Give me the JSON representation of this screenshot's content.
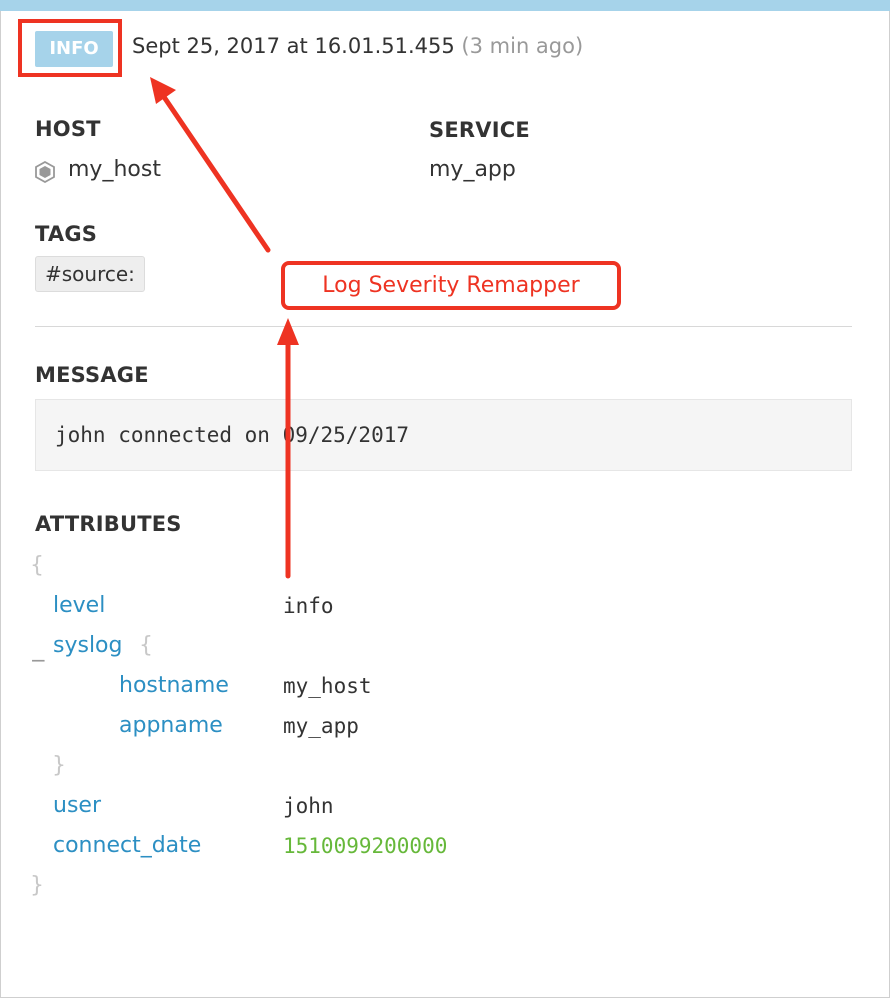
{
  "log": {
    "level_badge": "INFO",
    "timestamp": "Sept 25, 2017 at 16.01.51.455",
    "relative_time": "(3 min ago)"
  },
  "host": {
    "label": "HOST",
    "value": "my_host",
    "icon": "hexagon-icon"
  },
  "service": {
    "label": "SERVICE",
    "value": "my_app"
  },
  "tags": {
    "label": "TAGS",
    "items": [
      "#source:"
    ]
  },
  "annotation": {
    "label": "Log Severity Remapper",
    "color": "#ee3322"
  },
  "message": {
    "label": "MESSAGE",
    "text": "john connected on 09/25/2017"
  },
  "attributes": {
    "label": "ATTRIBUTES",
    "open_brace": "{",
    "close_brace": "}",
    "level": {
      "key": "level",
      "value": "info"
    },
    "syslog": {
      "toggle": "−",
      "key": "syslog",
      "open_brace": "{",
      "close_brace": "}",
      "hostname": {
        "key": "hostname",
        "value": "my_host"
      },
      "appname": {
        "key": "appname",
        "value": "my_app"
      }
    },
    "user": {
      "key": "user",
      "value": "john"
    },
    "connect_date": {
      "key": "connect_date",
      "value": "1510099200000"
    }
  },
  "colors": {
    "accent_bar": "#a6d3ea",
    "key_blue": "#2c8fc3",
    "number_green": "#66b83a"
  }
}
